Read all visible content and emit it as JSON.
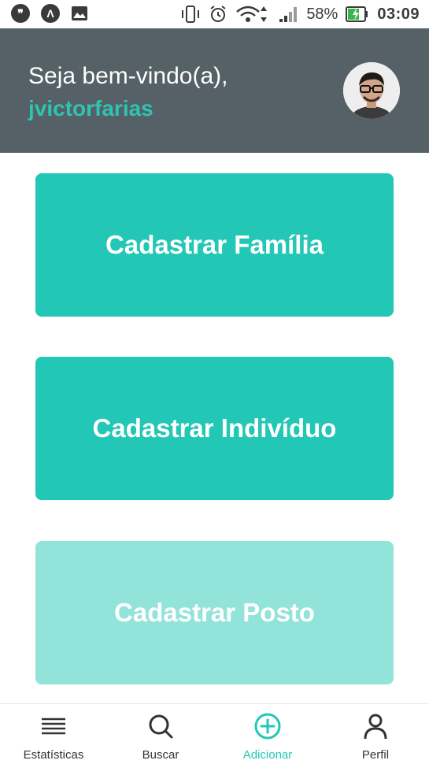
{
  "status_bar": {
    "battery": "58%",
    "time": "03:09",
    "left_icons": [
      "hangouts-icon",
      "arch-icon",
      "image-icon"
    ],
    "right_icons": [
      "vibrate-icon",
      "alarm-icon",
      "wifi-icon",
      "signal-icon",
      "battery-charging-icon"
    ]
  },
  "header": {
    "greeting": "Seja bem-vindo(a),",
    "username": "jvictorfarias"
  },
  "actions": [
    {
      "label": "Cadastrar Família"
    },
    {
      "label": "Cadastrar Indivíduo"
    },
    {
      "label": "Cadastrar Posto"
    }
  ],
  "bottom_nav": [
    {
      "label": "Estatísticas",
      "icon": "menu-lines-icon"
    },
    {
      "label": "Buscar",
      "icon": "search-icon"
    },
    {
      "label": "Adicionar",
      "icon": "plus-circle-icon",
      "active": true
    },
    {
      "label": "Perfil",
      "icon": "person-icon"
    }
  ],
  "colors": {
    "header_bg": "#556166",
    "accent": "#22c7b5",
    "accent_light": "#92e3da"
  }
}
